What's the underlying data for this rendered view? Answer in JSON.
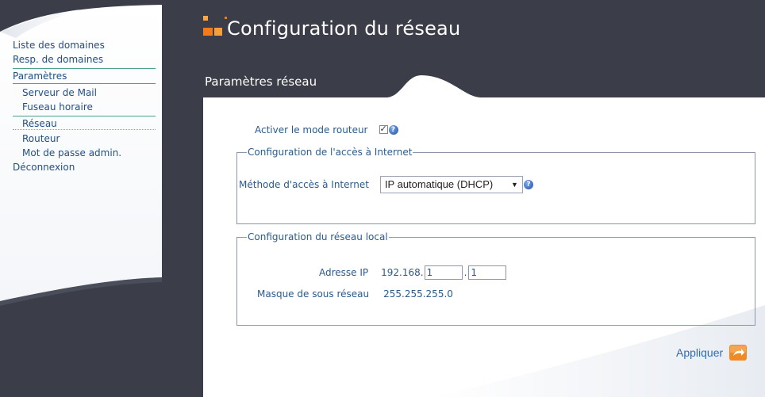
{
  "colors": {
    "background": "#3b3d48",
    "panel": "#ffffff",
    "link": "#1f4f86",
    "label": "#2b5a8c",
    "accent_orange": "#f08a24",
    "active_underline": "#4d9e8a"
  },
  "sidebar": {
    "items": [
      {
        "label": "Liste des domaines",
        "level": 0,
        "active": false
      },
      {
        "label": "Resp. de domaines",
        "level": 0,
        "active": false
      },
      {
        "label": "Paramètres",
        "level": 0,
        "active": true
      },
      {
        "label": "Serveur de Mail",
        "level": 1,
        "active": false
      },
      {
        "label": "Fuseau horaire",
        "level": 1,
        "active": false
      },
      {
        "label": "Réseau",
        "level": 1,
        "active": true
      },
      {
        "label": "Routeur",
        "level": 1,
        "active": false
      },
      {
        "label": "Mot de passe admin.",
        "level": 1,
        "active": false
      },
      {
        "label": "Déconnexion",
        "level": 0,
        "active": false
      }
    ]
  },
  "header": {
    "title": "Configuration du réseau",
    "logo_icon": "orange-squares-logo-icon"
  },
  "section": {
    "title": "Paramètres réseau"
  },
  "router_mode": {
    "label": "Activer le mode routeur",
    "checked": true,
    "help_icon": "help-icon"
  },
  "internet_access": {
    "legend": "Configuration de l'accès à Internet",
    "method_label": "Méthode d'accès à Internet",
    "method_value": "IP automatique (DHCP)",
    "help_icon": "help-icon"
  },
  "local_network": {
    "legend": "Configuration du réseau local",
    "ip_label": "Adresse IP",
    "ip_prefix": "192.168.",
    "ip_octet3": "1",
    "ip_separator": ".",
    "ip_octet4": "1",
    "mask_label": "Masque de sous réseau",
    "mask_value": "255.255.255.0"
  },
  "apply": {
    "label": "Appliquer",
    "icon": "orange-arrow-icon"
  }
}
